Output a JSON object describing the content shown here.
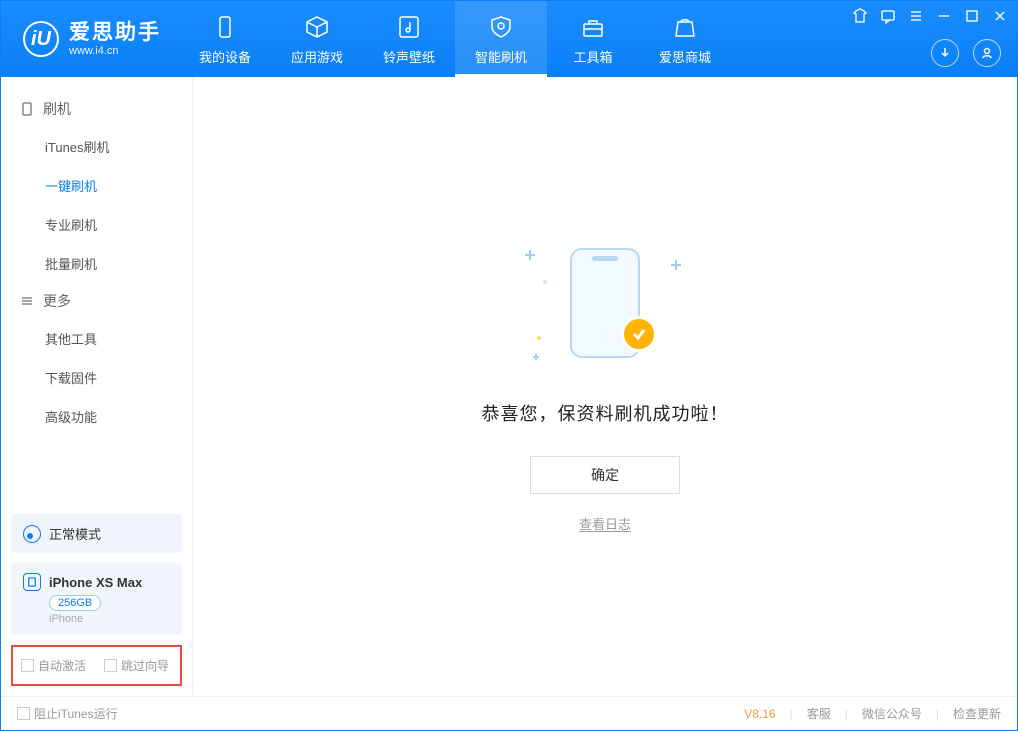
{
  "app": {
    "title": "爱思助手",
    "sub": "www.i4.cn"
  },
  "tabs": [
    {
      "label": "我的设备",
      "icon": "device"
    },
    {
      "label": "应用游戏",
      "icon": "cube"
    },
    {
      "label": "铃声壁纸",
      "icon": "music"
    },
    {
      "label": "智能刷机",
      "icon": "shield",
      "active": true
    },
    {
      "label": "工具箱",
      "icon": "toolbox"
    },
    {
      "label": "爱思商城",
      "icon": "bag"
    }
  ],
  "sidebar": {
    "groups": [
      {
        "title": "刷机",
        "icon": "phone",
        "items": [
          "iTunes刷机",
          "一键刷机",
          "专业刷机",
          "批量刷机"
        ],
        "activeIndex": 1
      },
      {
        "title": "更多",
        "icon": "menu",
        "items": [
          "其他工具",
          "下载固件",
          "高级功能"
        ],
        "activeIndex": -1
      }
    ],
    "mode": "正常模式",
    "device": {
      "name": "iPhone XS Max",
      "storage": "256GB",
      "type": "iPhone"
    },
    "checkboxes": {
      "autoActivate": "自动激活",
      "skipGuide": "跳过向导"
    }
  },
  "main": {
    "successText": "恭喜您，保资料刷机成功啦！",
    "okButton": "确定",
    "logLink": "查看日志"
  },
  "status": {
    "blockItunes": "阻止iTunes运行",
    "version": "V8.16",
    "links": [
      "客服",
      "微信公众号",
      "检查更新"
    ]
  }
}
